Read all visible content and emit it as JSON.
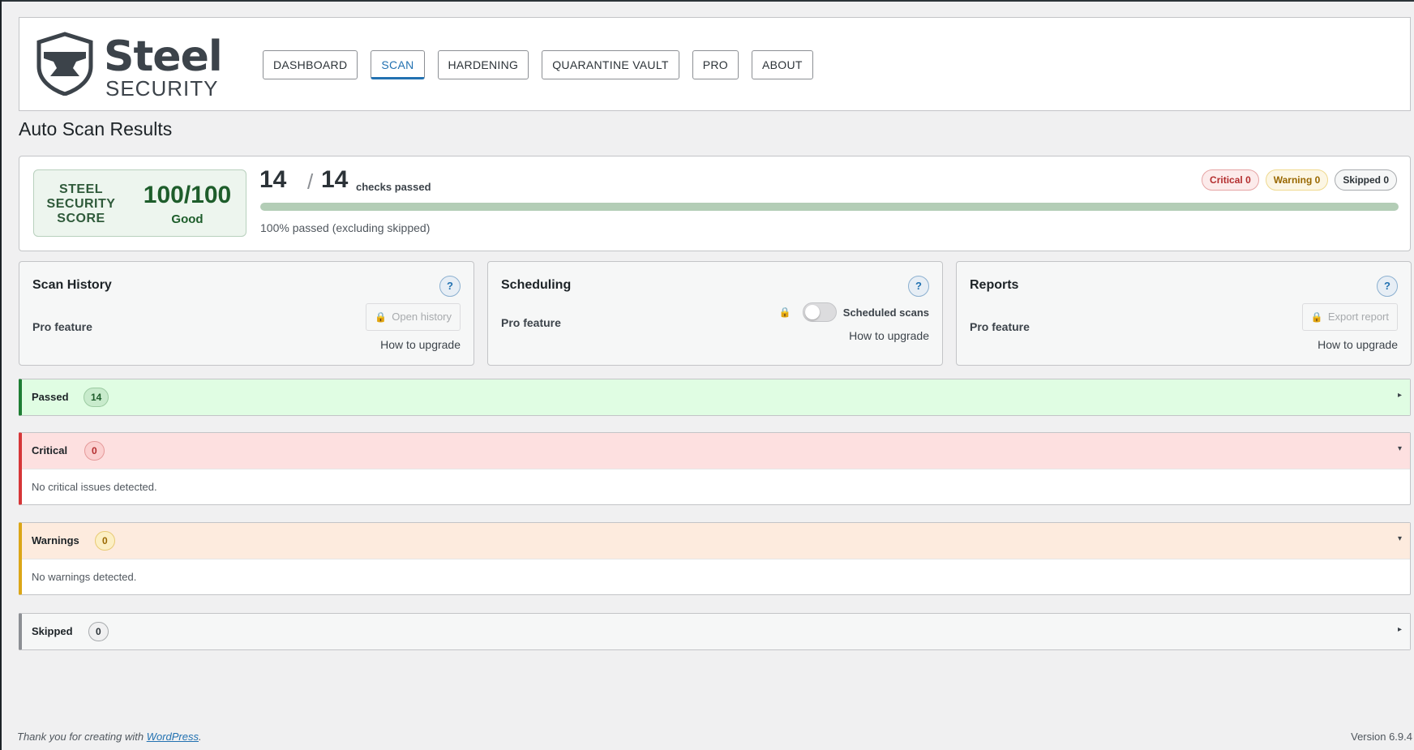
{
  "brand": {
    "name": "Steel",
    "subtitle": "SECURITY"
  },
  "nav": {
    "items": [
      {
        "label": "DASHBOARD",
        "active": false
      },
      {
        "label": "SCAN",
        "active": true
      },
      {
        "label": "HARDENING",
        "active": false
      },
      {
        "label": "QUARANTINE VAULT",
        "active": false
      },
      {
        "label": "PRO",
        "active": false
      },
      {
        "label": "ABOUT",
        "active": false
      }
    ]
  },
  "page": {
    "title": "Auto Scan Results"
  },
  "score": {
    "label": "STEEL SECURITY SCORE",
    "value": "100/100",
    "grade": "Good",
    "checks_passed": "14",
    "checks_slash": "/",
    "checks_total": "14",
    "checks_text": "checks passed",
    "progress_fraction": 1.0,
    "progress_caption": "100% passed (excluding skipped)",
    "badges": {
      "critical": "Critical 0",
      "warning": "Warning 0",
      "skipped": "Skipped 0"
    }
  },
  "cards": {
    "history": {
      "title": "Scan History",
      "help": "?",
      "pro": "Pro feature",
      "action": "Open history",
      "upgrade": "How to upgrade"
    },
    "scheduling": {
      "title": "Scheduling",
      "help": "?",
      "pro": "Pro feature",
      "toggle_label": "Scheduled scans",
      "toggle_on": false,
      "upgrade": "How to upgrade"
    },
    "reports": {
      "title": "Reports",
      "help": "?",
      "pro": "Pro feature",
      "action": "Export report",
      "upgrade": "How to upgrade"
    }
  },
  "sections": {
    "passed": {
      "title": "Passed",
      "count": "14",
      "arrow": "▸"
    },
    "critical": {
      "title": "Critical",
      "count": "0",
      "arrow": "▾",
      "message": "No critical issues detected."
    },
    "warnings": {
      "title": "Warnings",
      "count": "0",
      "arrow": "▾",
      "message": "No warnings detected."
    },
    "skipped": {
      "title": "Skipped",
      "count": "0",
      "arrow": "▸"
    }
  },
  "icons": {
    "lock": "lock-icon",
    "help": "help-icon",
    "anvil": "anvil-logo-icon"
  },
  "colors": {
    "accent": "#2271b1",
    "passed": "#1e7e34",
    "critical": "#d63638",
    "warning": "#dba617",
    "skipped": "#8c8f94"
  },
  "footer": {
    "thanks_prefix": "Thank you for creating with ",
    "thanks_link": "WordPress",
    "thanks_suffix": ".",
    "version": "Version 6.9.4"
  }
}
